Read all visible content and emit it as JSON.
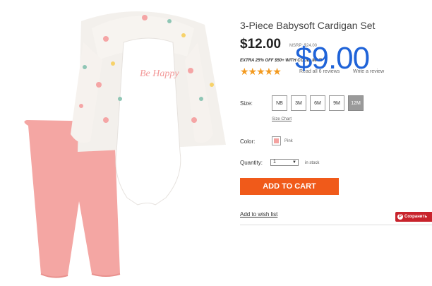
{
  "product": {
    "title": "3-Piece Babysoft Cardigan Set",
    "price": "$12.00",
    "msrp": "MSRP: $24.00",
    "overlay_price": "$9.00",
    "promo": "EXTRA 25% OFF $50+ WITH CODE: MAR",
    "rating_stars": "★★★★★",
    "rating_max": 5,
    "reviews_label": "Read all 6 reviews",
    "write_review_label": "Write a review",
    "image_caption": "Be Happy"
  },
  "size": {
    "label": "Size:",
    "options": [
      "NB",
      "3M",
      "6M",
      "9M",
      "12M"
    ],
    "selected": "12M",
    "chart_label": "Size Chart"
  },
  "color": {
    "label": "Color:",
    "name": "Pink",
    "hex": "#f4a2a0"
  },
  "quantity": {
    "label": "Quantity:",
    "value": "1",
    "stock": "in stock"
  },
  "actions": {
    "add_to_cart": "ADD TO CART",
    "wishlist": "Add to wish list",
    "pinterest": "Сохранить"
  },
  "colors": {
    "accent": "#f05a1a",
    "price_overlay": "#1f63d8",
    "star": "#f39a1f",
    "pinterest": "#c8232c"
  }
}
